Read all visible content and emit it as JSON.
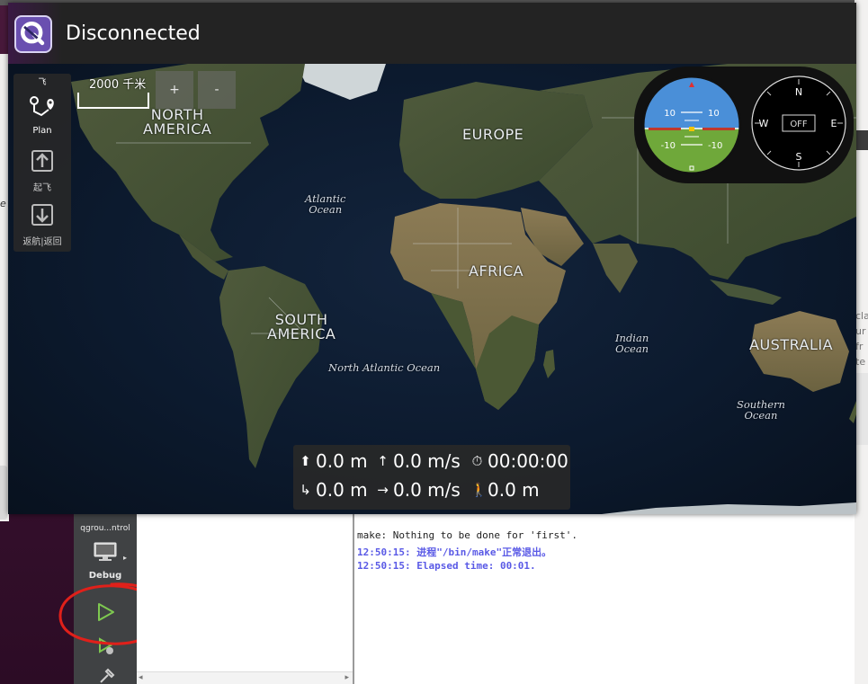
{
  "window": {
    "title": "Disconnected"
  },
  "plan_toolbar": {
    "top_label": "飞",
    "plan_label": "Plan",
    "takeoff_label": "起飞",
    "rtl_label": "返航|返回"
  },
  "map": {
    "scale_label": "2000 千米",
    "zoom_in": "+",
    "zoom_out": "-",
    "labels": {
      "north_america": "NORTH\nAMERICA",
      "europe": "EUROPE",
      "atlantic_ocean": "Atlantic\nOcean",
      "africa": "AFRICA",
      "south_america": "SOUTH\nAMERICA",
      "north_atlantic_ocean": "North Atlantic Ocean",
      "indian_ocean": "Indian\nOcean",
      "australia": "AUSTRALIA",
      "southern_ocean": "Southern\nOcean"
    }
  },
  "instruments": {
    "attitude": {
      "pitch_up": "10",
      "pitch_down": "-10"
    },
    "compass": {
      "n": "N",
      "e": "E",
      "s": "S",
      "w": "W",
      "status": "OFF"
    }
  },
  "telemetry": {
    "altitude": "0.0 m",
    "vertical_speed": "0.0 m/s",
    "flight_time": "00:00:00",
    "distance_home": "0.0 m",
    "ground_speed": "0.0 m/s",
    "distance": "0.0 m"
  },
  "ide": {
    "kit_label": "qgrou...ntrol",
    "build_mode": "Debug",
    "output_lines": [
      "make: Nothing to be done for 'first'.",
      "12:50:15: 进程\"/bin/make\"正常退出。",
      "12:50:15: Elapsed time: 00:01."
    ],
    "right_panel_chars": [
      "cla",
      "ur",
      "fr",
      "te"
    ],
    "left_strip_char": "e"
  },
  "colors": {
    "sky": "#4a8fd8",
    "ground": "#6fa83a",
    "output_blue": "#5a5ae6",
    "annotation_red": "#e0201a"
  }
}
